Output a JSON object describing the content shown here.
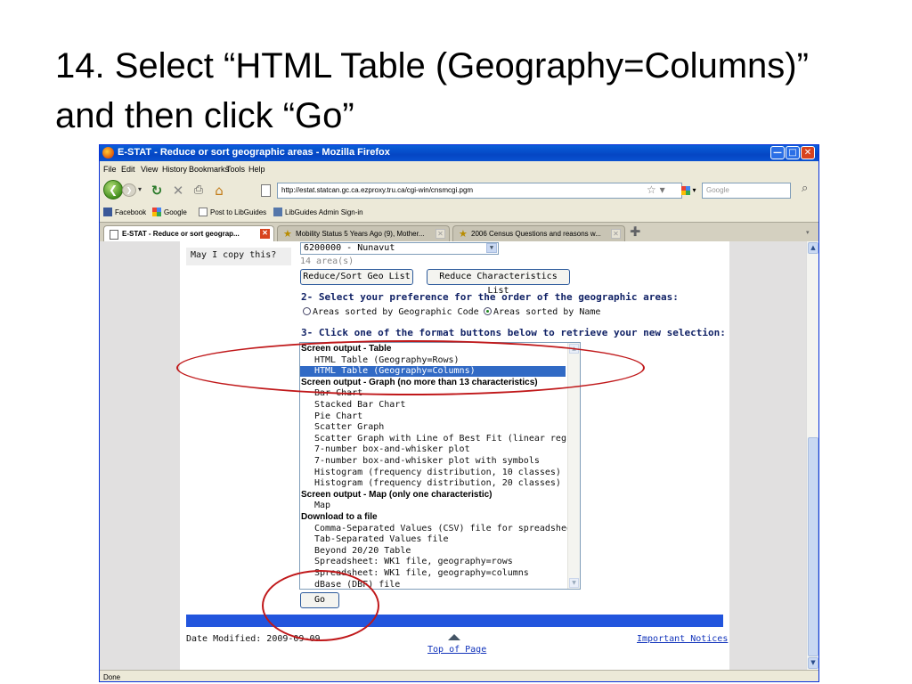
{
  "slide": {
    "title_line1": "14. Select “HTML Table (Geography=Columns)”",
    "title_line2": "and then click “Go”"
  },
  "window": {
    "title": "E-STAT - Reduce or sort geographic areas - Mozilla Firefox"
  },
  "menubar": [
    "File",
    "Edit",
    "View",
    "History",
    "Bookmarks",
    "Tools",
    "Help"
  ],
  "toolbar": {
    "url": "http://estat.statcan.gc.ca.ezproxy.tru.ca/cgi-win/cnsmcgi.pgm",
    "search_placeholder": "Google"
  },
  "bookmarks": [
    "Facebook",
    "Google",
    "Post to LibGuides",
    "LibGuides Admin Sign-in"
  ],
  "tabs": [
    {
      "label": "E-STAT - Reduce or sort geograp...",
      "active": true
    },
    {
      "label": "Mobility Status 5 Years Ago (9), Mother...",
      "active": false
    },
    {
      "label": "2006 Census Questions and reasons w...",
      "active": false
    }
  ],
  "page": {
    "copy_question": "May I copy this?",
    "geo_selected": "6200000 - Nunavut",
    "area_count": "14 area(s)",
    "reduce_geo_label": "Reduce/Sort Geo List",
    "reduce_char_label": "Reduce Characteristics List",
    "order_heading": "2- Select your preference for the order of the geographic areas:",
    "radio_code_label": "Areas sorted by Geographic Code",
    "radio_name_label": "Areas sorted by Name",
    "format_heading": "3- Click one of the format buttons below to retrieve your new selection:",
    "format_list": [
      {
        "text": "Screen output - Table",
        "group": true
      },
      {
        "text": "HTML Table (Geography=Rows)",
        "group": false
      },
      {
        "text": "HTML Table (Geography=Columns)",
        "group": false,
        "selected": true
      },
      {
        "text": "Screen output - Graph (no more than 13 characteristics)",
        "group": true
      },
      {
        "text": "Bar Chart",
        "group": false
      },
      {
        "text": "Stacked Bar Chart",
        "group": false
      },
      {
        "text": "Pie Chart",
        "group": false
      },
      {
        "text": "Scatter Graph",
        "group": false
      },
      {
        "text": "Scatter Graph with Line of Best Fit (linear regression)",
        "group": false
      },
      {
        "text": "7-number box-and-whisker plot",
        "group": false
      },
      {
        "text": "7-number box-and-whisker plot with symbols",
        "group": false
      },
      {
        "text": "Histogram (frequency distribution, 10 classes)",
        "group": false
      },
      {
        "text": "Histogram (frequency distribution, 20 classes)",
        "group": false
      },
      {
        "text": "Screen output - Map (only one characteristic)",
        "group": true
      },
      {
        "text": "Map",
        "group": false
      },
      {
        "text": "Download to a file",
        "group": true
      },
      {
        "text": "Comma-Separated Values (CSV) file for spreadsheet",
        "group": false
      },
      {
        "text": "Tab-Separated Values file",
        "group": false
      },
      {
        "text": "Beyond 20/20 Table",
        "group": false
      },
      {
        "text": "Spreadsheet: WK1 file, geography=rows",
        "group": false
      },
      {
        "text": "Spreadsheet: WK1 file, geography=columns",
        "group": false
      },
      {
        "text": "dBase (DBF) file",
        "group": false
      }
    ],
    "go_label": "Go",
    "date_modified": "Date Modified: 2009-09-09",
    "top_of_page": "Top of Page",
    "important_notices": "Important Notices"
  },
  "status": "Done",
  "colors": {
    "selection": "#316ac5",
    "annotation": "#c0181a",
    "strip": "#2255dd"
  }
}
